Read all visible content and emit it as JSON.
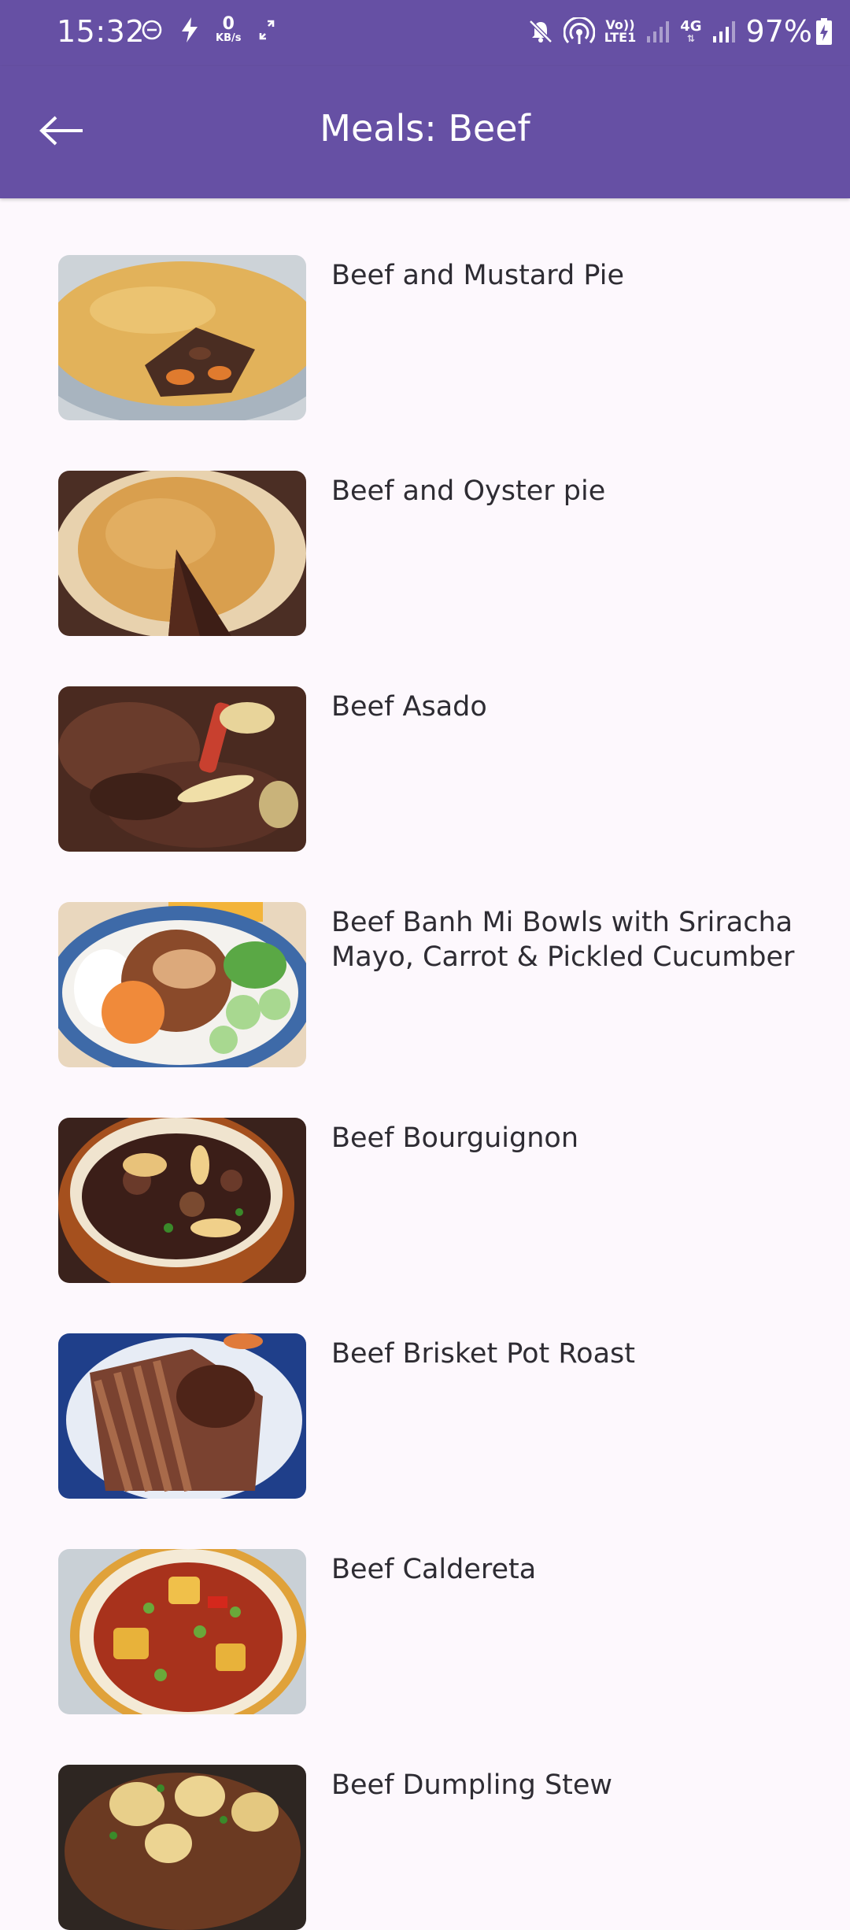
{
  "status_bar": {
    "time": "15:32",
    "left_icons": [
      "do-not-disturb-icon",
      "lightning-icon",
      "data-speed-icon",
      "screen-rotate-icon"
    ],
    "data_speed_value": "0",
    "data_speed_unit": "KB/s",
    "right_icons": [
      "mute-icon",
      "hotspot-icon",
      "volte-icon",
      "signal-icon",
      "4g-icon",
      "signal-icon",
      "battery-charging-icon"
    ],
    "volte_top": "Vo))",
    "volte_bottom": "LTE1",
    "network_type": "4G",
    "battery_percent": "97%",
    "colors": {
      "background": "#6650a4",
      "foreground": "#ffffff"
    }
  },
  "app_bar": {
    "title": "Meals: Beef",
    "back_icon": "arrow-left-icon",
    "colors": {
      "background": "#6650a4",
      "foreground": "#ffffff"
    }
  },
  "meals": [
    {
      "name": "Beef and Mustard Pie",
      "image": "pie-thumbnail"
    },
    {
      "name": "Beef and Oyster pie",
      "image": "pie-thumbnail"
    },
    {
      "name": "Beef Asado",
      "image": "stew-thumbnail"
    },
    {
      "name": "Beef Banh Mi Bowls with Sriracha Mayo, Carrot & Pickled Cucumber",
      "image": "bowl-thumbnail"
    },
    {
      "name": "Beef Bourguignon",
      "image": "stew-thumbnail"
    },
    {
      "name": "Beef Brisket Pot Roast",
      "image": "roast-thumbnail"
    },
    {
      "name": "Beef Caldereta",
      "image": "stew-thumbnail"
    },
    {
      "name": "Beef Dumpling Stew",
      "image": "stew-thumbnail"
    }
  ]
}
